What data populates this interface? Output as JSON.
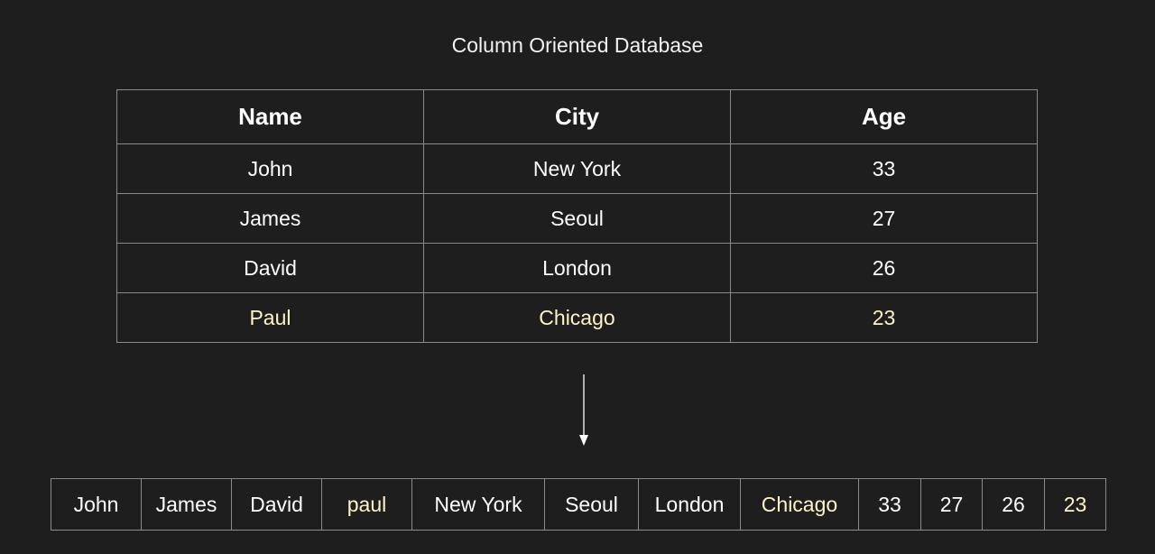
{
  "title": "Column Oriented Database",
  "colors": {
    "background": "#1e1e1e",
    "text": "#ffffff",
    "highlight": "#fff3c4",
    "border": "#8a8a8a"
  },
  "table": {
    "headers": [
      "Name",
      "City",
      "Age"
    ],
    "rows": [
      [
        "John",
        "New York",
        "33"
      ],
      [
        "James",
        "Seoul",
        "27"
      ],
      [
        "David",
        "London",
        "26"
      ],
      [
        "Paul",
        "Chicago",
        "23"
      ]
    ],
    "highlighted_row_index": 3
  },
  "arrow_icon": "down-arrow-icon",
  "column_storage": {
    "cells": [
      "John",
      "James",
      "David",
      "paul",
      "New York",
      "Seoul",
      "London",
      "Chicago",
      "33",
      "27",
      "26",
      "23"
    ],
    "highlighted_indices": [
      3,
      7,
      11
    ]
  }
}
